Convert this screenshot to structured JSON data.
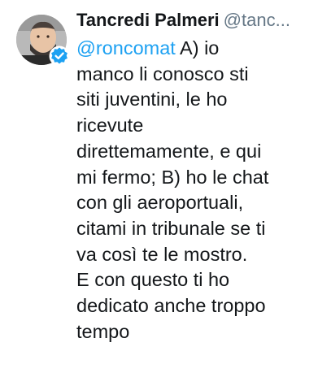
{
  "tweet": {
    "author_name": "Tancredi Palmeri",
    "author_handle": "@tanc...",
    "mention": "@roncomat",
    "first_line_rest": " A) io",
    "lines": [
      "manco li conosco sti",
      "siti juventini, le ho",
      "ricevute",
      "direttemamente, e qui",
      "mi fermo; B) ho le chat",
      "con gli aeroportuali,",
      "citami in tribunale se ti",
      "va così te le mostro.",
      "E con questo ti ho",
      "dedicato anche troppo",
      "tempo"
    ]
  },
  "colors": {
    "text": "#14171a",
    "mention": "#1da1f2",
    "handle": "#657786",
    "verified_badge": "#1da1f2"
  },
  "icons": {
    "avatar": "profile-photo",
    "badge": "verified-check-icon"
  }
}
